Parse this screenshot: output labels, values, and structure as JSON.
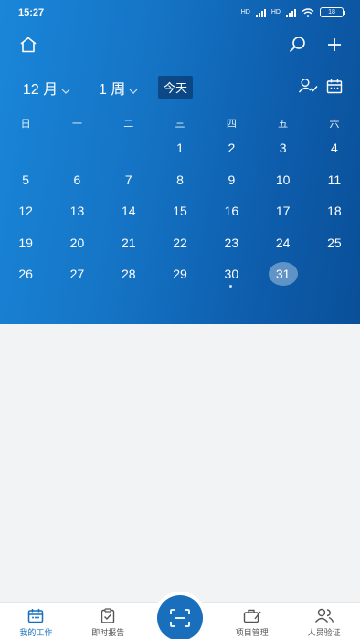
{
  "status": {
    "time": "15:27",
    "net1": "HD",
    "net2": "HD",
    "battery": "18"
  },
  "header": {
    "month_label": "12 月",
    "week_label": "1 周",
    "today_label": "今天"
  },
  "calendar": {
    "weekdays": [
      "日",
      "一",
      "二",
      "三",
      "四",
      "五",
      "六"
    ],
    "selected_day": 31,
    "event_day": 30,
    "days": [
      "",
      "",
      "",
      "1",
      "2",
      "3",
      "4",
      "5",
      "6",
      "7",
      "8",
      "9",
      "10",
      "11",
      "12",
      "13",
      "14",
      "15",
      "16",
      "17",
      "18",
      "19",
      "20",
      "21",
      "22",
      "23",
      "24",
      "25",
      "26",
      "27",
      "28",
      "29",
      "30",
      "31",
      ""
    ]
  },
  "tabs": [
    {
      "label": "我的工作",
      "icon": "calendar-icon",
      "active": true
    },
    {
      "label": "即时报告",
      "icon": "clipboard-check-icon",
      "active": false
    },
    {
      "label": "",
      "icon": "scan-icon",
      "active": false
    },
    {
      "label": "项目管理",
      "icon": "toolbox-icon",
      "active": false
    },
    {
      "label": "人员验证",
      "icon": "people-icon",
      "active": false
    }
  ],
  "colors": {
    "header_start": "#1a86d8",
    "header_end": "#0a4f98",
    "accent": "#1a6fbd"
  }
}
